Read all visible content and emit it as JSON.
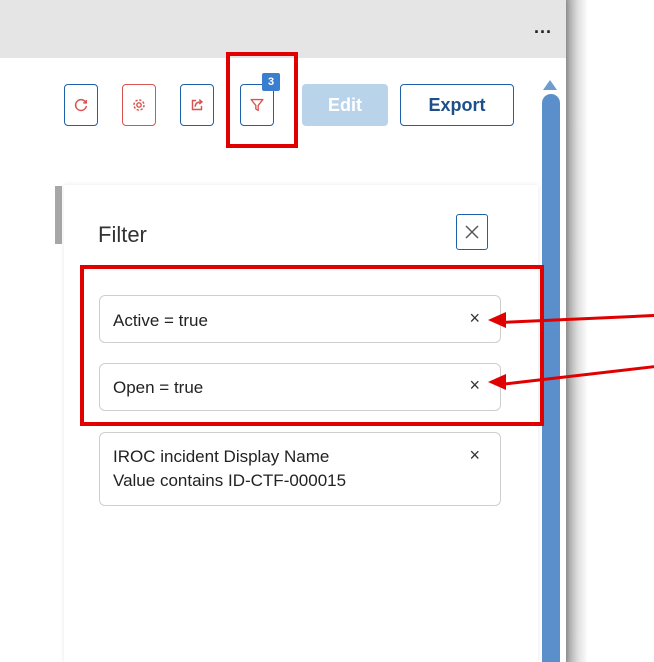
{
  "toolbar": {
    "more_label": "...",
    "filter_badge": "3",
    "edit_label": "Edit",
    "export_label": "Export"
  },
  "filter_panel": {
    "title": "Filter",
    "chips": [
      {
        "line1": "Active = true"
      },
      {
        "line1": "Open = true"
      },
      {
        "line1": "IROC incident Display Name",
        "line2": "Value contains ID-CTF-000015"
      }
    ],
    "chip_remove_glyph": "×"
  },
  "colors": {
    "primary_blue": "#1d62a8",
    "danger_red": "#d9534f",
    "highlight_red": "#e00000",
    "disabled_blue": "#b9d3ea",
    "badge_blue": "#3a7fcf"
  },
  "icons": [
    "refresh-icon",
    "settings-icon",
    "share-icon",
    "filter-icon",
    "close-icon",
    "remove-icon"
  ]
}
